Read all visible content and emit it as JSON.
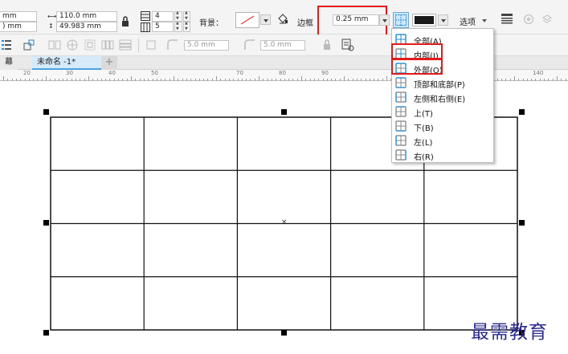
{
  "toolbar": {
    "width_partial": "mm",
    "height_partial": "  mm",
    "width_value": "110.0 mm",
    "height_value": "49.983 mm",
    "rows_value": "4",
    "cols_value": "5",
    "background_label": "背景：",
    "border_label": "边框",
    "border_width_value": "0.25 mm",
    "options_label": "选项",
    "border_color": "#1a1a1a"
  },
  "toolbar2": {
    "corner_radius_1": "5.0 mm",
    "corner_radius_2": "5.0 mm"
  },
  "tabs": {
    "left_partial": "幕",
    "document": "未命名 -1*",
    "add": "+"
  },
  "ruler": {
    "labels": [
      "20",
      "30",
      "40",
      "50",
      "70",
      "80",
      "90",
      "140"
    ]
  },
  "border_menu": {
    "items": [
      {
        "label": "全部(A)"
      },
      {
        "label": "内部(I)"
      },
      {
        "label": "外部(O)"
      },
      {
        "label": "顶部和底部(P)"
      },
      {
        "label": "左侧和右侧(E)"
      },
      {
        "label": "上(T)"
      },
      {
        "label": "下(B)"
      },
      {
        "label": "左(L)"
      },
      {
        "label": "右(R)"
      }
    ]
  },
  "table": {
    "rows": 4,
    "cols": 5
  },
  "watermark": "最需教育",
  "colors": {
    "highlight": "#e21a1a",
    "icon_blue": "#1e8ad6",
    "selected_bg": "#cfe8fb"
  }
}
